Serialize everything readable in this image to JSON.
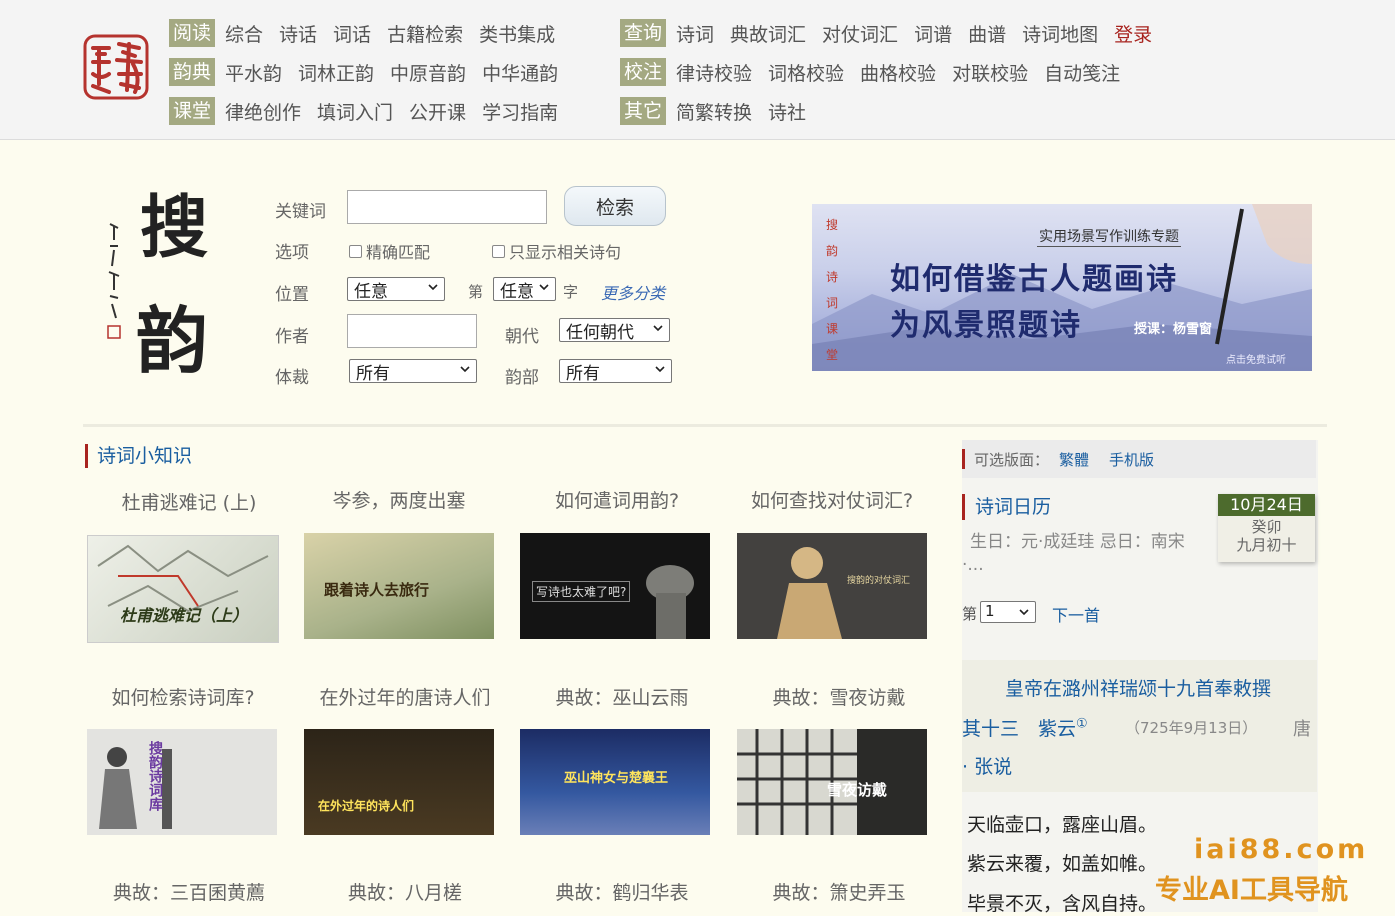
{
  "header": {
    "rows": [
      {
        "tag": "阅读",
        "links": [
          "综合",
          "诗话",
          "词话",
          "古籍检索",
          "类书集成"
        ]
      },
      {
        "tag": "韵典",
        "links": [
          "平水韵",
          "词林正韵",
          "中原音韵",
          "中华通韵"
        ]
      },
      {
        "tag": "课堂",
        "links": [
          "律绝创作",
          "填词入门",
          "公开课",
          "学习指南"
        ]
      }
    ],
    "rows2": [
      {
        "tag": "查询",
        "links": [
          "诗词",
          "典故词汇",
          "对仗词汇",
          "词谱",
          "曲谱",
          "诗词地图"
        ],
        "extra": "登录"
      },
      {
        "tag": "校注",
        "links": [
          "律诗校验",
          "词格校验",
          "曲格校验",
          "对联校验",
          "自动笺注"
        ]
      },
      {
        "tag": "其它",
        "links": [
          "简繁转换",
          "诗社"
        ]
      }
    ]
  },
  "search": {
    "keyword_label": "关键词",
    "search_button": "检索",
    "options_label": "选项",
    "exact_match": "精确匹配",
    "related_only": "只显示相关诗句",
    "position_label": "位置",
    "position_value": "任意",
    "nth_label": "第",
    "nth_value": "任意",
    "char_label": "字",
    "more_categories": "更多分类",
    "author_label": "作者",
    "dynasty_label": "朝代",
    "dynasty_value": "任何朝代",
    "genre_label": "体裁",
    "genre_value": "所有",
    "rhyme_label": "韵部",
    "rhyme_value": "所有",
    "logo_chars": [
      "搜",
      "韵"
    ],
    "seal_text": "韵搜"
  },
  "banner": {
    "side_text": "搜韵诗词课堂",
    "tag": "实用场景写作训练专题",
    "line1": "如何借鉴古人题画诗",
    "line2": "为风景照题诗",
    "teacher": "授课：杨雪窗",
    "try": "点击免费试听"
  },
  "knowledge": {
    "title": "诗词小知识",
    "items": [
      {
        "caption": "杜甫逃难记 (上)",
        "thumb_text": "杜甫逃难记（上）"
      },
      {
        "caption": "岑参，两度出塞",
        "thumb_text": "跟着诗人去旅行"
      },
      {
        "caption": "如何遣词用韵?",
        "thumb_text": "写诗也太难了吧?"
      },
      {
        "caption": "如何查找对仗词汇?",
        "thumb_text": "搜韵的对仗词汇"
      },
      {
        "caption": "如何检索诗词库?",
        "thumb_text": "搜韵诗词库"
      },
      {
        "caption": "在外过年的唐诗人们",
        "thumb_text": "在外过年的诗人们"
      },
      {
        "caption": "典故：巫山云雨",
        "thumb_text": "巫山神女与楚襄王"
      },
      {
        "caption": "典故：雪夜访戴",
        "thumb_text": "雪夜访戴"
      },
      {
        "caption": "典故：三百囷黄薦",
        "thumb_text": ""
      },
      {
        "caption": "典故：八月槎",
        "thumb_text": ""
      },
      {
        "caption": "典故：鹤归华表",
        "thumb_text": ""
      },
      {
        "caption": "典故：箫史弄玉",
        "thumb_text": ""
      }
    ]
  },
  "right": {
    "version_label": "可选版面：",
    "version_links": [
      "繁體",
      "手机版"
    ],
    "calendar_title": "诗词日历",
    "cal_date": "10月24日",
    "cal_ganzhi": "癸卯",
    "cal_lunar": "九月初十",
    "cal_info": "生日：元·成廷珪 忌日：南宋",
    "cal_info2": "·...",
    "pager_label": "第",
    "pager_value": "1",
    "pager_next": "下一首",
    "poem_title": "皇帝在潞州祥瑞颂十九首奉敕撰",
    "poem_sub": "其十三　紫云",
    "poem_note": "①",
    "poem_date": "（725年9月13日）",
    "poem_dynasty": "唐",
    "poem_author": "· 张说",
    "verses": [
      "天临壶口，露座山眉。",
      "紫云来覆，如盖如帷。",
      "毕景不灭，含风自持。"
    ]
  },
  "watermark": {
    "line1": "iai88.com",
    "line2": "专业AI工具导航"
  },
  "colors": {
    "accent": "#a8241f",
    "nav_tag": "#a4a982",
    "link": "#1a5ea0",
    "page_bg": "#fdfcef",
    "calendar_green": "#4d6b2d"
  }
}
